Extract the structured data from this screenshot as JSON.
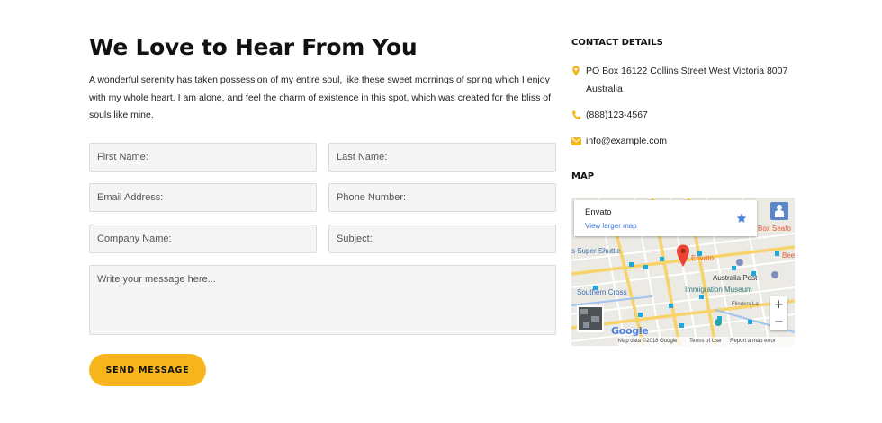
{
  "page": {
    "title": "We Love to Hear From You",
    "intro": "A wonderful serenity has taken possession of my entire soul, like these sweet mornings of spring which I enjoy with my whole heart. I am alone, and feel the charm of existence in this spot, which was created for the bliss of souls like mine."
  },
  "form": {
    "first_name_placeholder": "First Name:",
    "last_name_placeholder": "Last Name:",
    "email_placeholder": "Email Address:",
    "phone_placeholder": "Phone Number:",
    "company_placeholder": "Company Name:",
    "subject_placeholder": "Subject:",
    "message_placeholder": "Write your message here...",
    "submit_label": "SEND MESSAGE"
  },
  "contact": {
    "heading": "CONTACT DETAILS",
    "address_line1": "PO Box 16122 Collins Street West Victoria 8007",
    "address_line2": "Australia",
    "phone": "(888)123-4567",
    "email": "info@example.com",
    "address_icon": "map-pin-icon",
    "phone_icon": "phone-icon",
    "email_icon": "envelope-icon",
    "icon_color": "#f7b61c"
  },
  "map": {
    "heading": "MAP",
    "place_name": "Envato",
    "larger_map_link": "View larger map",
    "labels": {
      "envato": "Envato",
      "box_seafood": "Box Seafo",
      "super_shuttle": "s Super Shuttle",
      "bee": "Bee",
      "australia_post": "Australia Post",
      "immigration_museum": "Immigration Museum",
      "southern_cross": "Southern Cross",
      "flinders": "Flinders La"
    },
    "google_logo": "Google",
    "attribution": "Map data ©2018 Google",
    "terms": "Terms of Use",
    "report": "Report a map error",
    "zoom_in": "+",
    "zoom_out": "−",
    "pin_color": "#ea4335",
    "road_color": "#f8d26a"
  }
}
